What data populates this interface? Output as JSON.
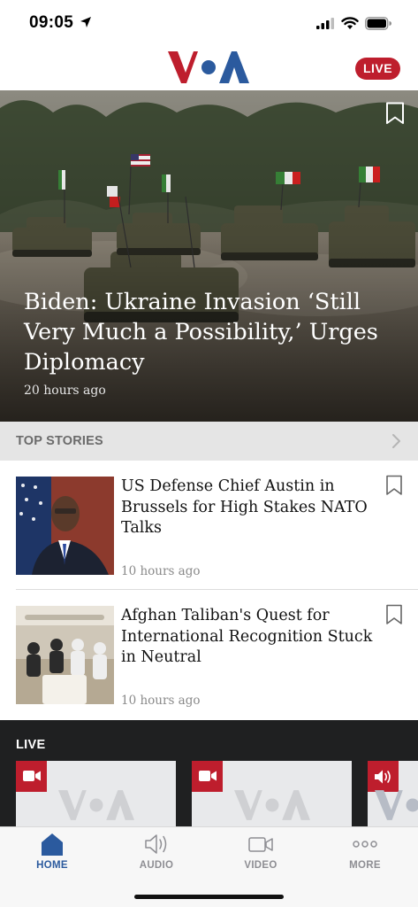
{
  "status_bar": {
    "time": "09:05"
  },
  "header": {
    "logo_icon": "voa-logo",
    "live_label": "LIVE",
    "accent_color": "#be1e2d"
  },
  "hero": {
    "title": "Biden: Ukraine Invasion ‘Still Very Much a Possibility,’ Urges Diplomacy",
    "time": "20 hours ago"
  },
  "top_stories": {
    "section_title": "TOP STORIES",
    "items": [
      {
        "title": "US Defense Chief Austin in Brussels for High Stakes NATO Talks",
        "time": "10 hours ago"
      },
      {
        "title": "Afghan Taliban's Quest for International Recognition Stuck in Neutral",
        "time": "10 hours ago"
      }
    ]
  },
  "live_section": {
    "label": "LIVE",
    "cards": [
      {
        "type": "video",
        "icon": "video-camera-icon"
      },
      {
        "type": "video",
        "icon": "video-camera-icon"
      },
      {
        "type": "audio",
        "icon": "speaker-icon"
      }
    ]
  },
  "tab_bar": {
    "tabs": [
      {
        "label": "HOME",
        "icon": "home-icon",
        "active": true
      },
      {
        "label": "AUDIO",
        "icon": "speaker-icon",
        "active": false
      },
      {
        "label": "VIDEO",
        "icon": "video-camera-icon",
        "active": false
      },
      {
        "label": "MORE",
        "icon": "more-dots-icon",
        "active": false
      }
    ],
    "active_color": "#2b5a9e"
  }
}
